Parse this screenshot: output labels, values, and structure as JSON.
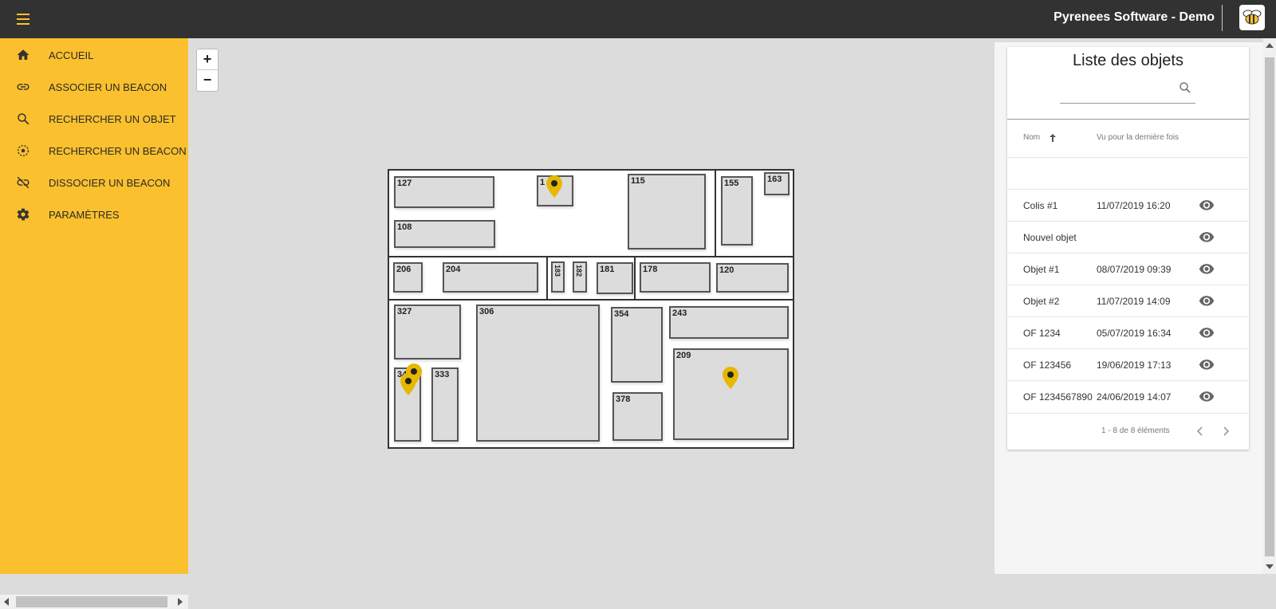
{
  "header": {
    "title": "Pyrenees Software - Demo",
    "logo_icon": "bee-icon",
    "menu_icon": "hamburger-icon"
  },
  "theme": {
    "accent": "#fbc02d",
    "topbar": "#323232",
    "pin": "#e6b800"
  },
  "sidebar": {
    "items": [
      {
        "label": "ACCUEIL",
        "icon": "home-icon"
      },
      {
        "label": "ASSOCIER UN BEACON",
        "icon": "link-icon"
      },
      {
        "label": "RECHERCHER UN OBJET",
        "icon": "search-icon"
      },
      {
        "label": "RECHERCHER UN BEACON",
        "icon": "beacon-icon"
      },
      {
        "label": "DISSOCIER UN BEACON",
        "icon": "link-off-icon"
      },
      {
        "label": "PARAMÈTRES",
        "icon": "gear-icon"
      }
    ]
  },
  "map": {
    "zoom_in": "+",
    "zoom_out": "−",
    "cells": [
      "127",
      "1",
      "115",
      "155",
      "163",
      "108",
      "206",
      "204",
      "183",
      "182",
      "181",
      "178",
      "120",
      "327",
      "306",
      "354",
      "243",
      "209",
      "34",
      "333",
      "378"
    ]
  },
  "panel": {
    "title": "Liste des objets",
    "search": {
      "value": "",
      "placeholder": ""
    },
    "columns": {
      "name": "Nom",
      "seen": "Vu pour la dernière fois"
    },
    "rows": [
      {
        "name": "",
        "seen": ""
      },
      {
        "name": "Colis #1",
        "seen": "11/07/2019 16:20"
      },
      {
        "name": "Nouvel objet",
        "seen": ""
      },
      {
        "name": "Objet #1",
        "seen": "08/07/2019 09:39"
      },
      {
        "name": "Objet #2",
        "seen": "11/07/2019 14:09"
      },
      {
        "name": "OF 1234",
        "seen": "05/07/2019 16:34"
      },
      {
        "name": "OF 123456",
        "seen": "19/06/2019 17:13"
      },
      {
        "name": "OF 1234567890",
        "seen": "24/06/2019 14:07"
      }
    ],
    "pager": {
      "info": "1 - 8 de 8 éléments"
    }
  }
}
